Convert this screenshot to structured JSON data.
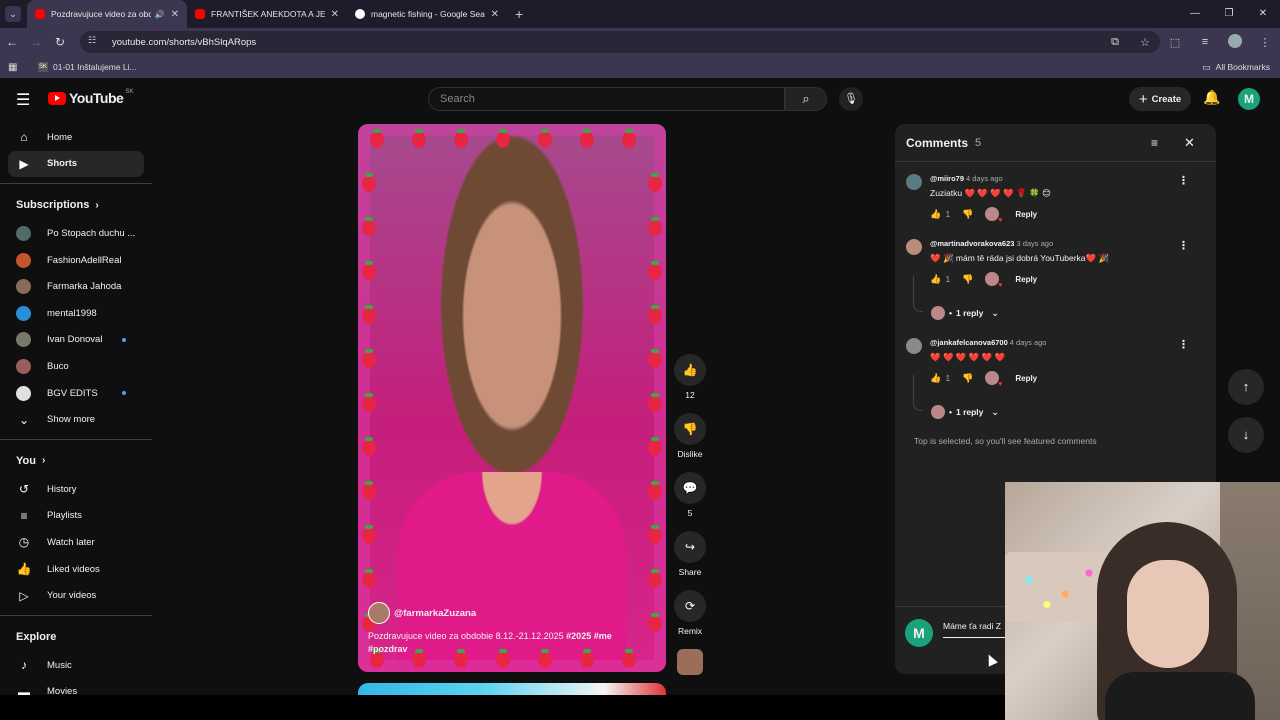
{
  "browser": {
    "tabs": [
      {
        "title": "Pozdravujuce video za obdobie",
        "active": true
      },
      {
        "title": "FRANTIŠEK ANEKDOTA A JEHO",
        "active": false
      },
      {
        "title": "magnetic fishing - Google Search",
        "active": false
      }
    ],
    "url": "youtube.com/shorts/vBhSlqARops",
    "bookmark": "01-01 Inštalujeme Li...",
    "all_bookmarks": "All Bookmarks"
  },
  "youtube": {
    "logo": "YouTube",
    "country": "SK",
    "search_placeholder": "Search",
    "create_label": "Create",
    "user_initial": "M"
  },
  "sidebar": {
    "main": [
      {
        "label": "Home",
        "icon": "home-icon"
      },
      {
        "label": "Shorts",
        "icon": "shorts-icon"
      }
    ],
    "subscriptions_title": "Subscriptions",
    "subscriptions": [
      {
        "label": "Po Stopach duchu ...",
        "color": "#4f6b6a",
        "dot": false
      },
      {
        "label": "FashionAdellReal",
        "color": "#c4552e",
        "dot": false
      },
      {
        "label": "Farmarka Jahoda",
        "color": "#8a6a58",
        "dot": false
      },
      {
        "label": "mental1998",
        "color": "#2a8fd6",
        "dot": false
      },
      {
        "label": "Ivan Donoval",
        "color": "#777a6a",
        "dot": true
      },
      {
        "label": "Buco",
        "color": "#9a5d5a",
        "dot": false
      },
      {
        "label": "BGV EDITS",
        "color": "#e0e0e0",
        "dot": true
      }
    ],
    "show_more": "Show more",
    "you_title": "You",
    "you": [
      {
        "label": "History",
        "icon": "history-icon"
      },
      {
        "label": "Playlists",
        "icon": "playlists-icon"
      },
      {
        "label": "Watch later",
        "icon": "watch-later-icon"
      },
      {
        "label": "Liked videos",
        "icon": "like-icon"
      },
      {
        "label": "Your videos",
        "icon": "your-videos-icon"
      }
    ],
    "explore_title": "Explore",
    "explore": [
      {
        "label": "Music",
        "icon": "music-icon"
      },
      {
        "label": "Movies",
        "icon": "movies-icon"
      }
    ]
  },
  "short": {
    "channel": "@farmarkaZuzana",
    "description": "Pozdravujuce video za obdobie 8.12.-21.12.2025",
    "hashtags": [
      "#2025",
      "#me",
      "#pozdrav"
    ],
    "likes": "12",
    "dislike_label": "Dislike",
    "comments": "5",
    "share_label": "Share",
    "remix_label": "Remix"
  },
  "comments": {
    "title": "Comments",
    "count": "5",
    "items": [
      {
        "handle": "@miiro79",
        "time": "4 days ago",
        "text": "Zuziatku ❤️ ❤️ ❤️ ❤️ 🌹 🍀 😊",
        "likes": "1",
        "avatar_color": "#5c7a86",
        "replies": null
      },
      {
        "handle": "@martinadvorakova623",
        "time": "3 days ago",
        "text": "❤️ 🎉 mám tě ráda jsi dobrá YouTuberka❤️ 🎉",
        "likes": "1",
        "avatar_color": "#b98d7a",
        "replies": "1 reply"
      },
      {
        "handle": "@jankafelcanova6700",
        "time": "4 days ago",
        "text": "❤️ ❤️ ❤️ ❤️ ❤️ ❤️",
        "likes": "1",
        "avatar_color": "#8a8a8a",
        "replies": "1 reply"
      }
    ],
    "reply_label": "Reply",
    "featured_note": "Top is selected, so you'll see featured comments",
    "input_value": "Máme ťa radi Z"
  }
}
